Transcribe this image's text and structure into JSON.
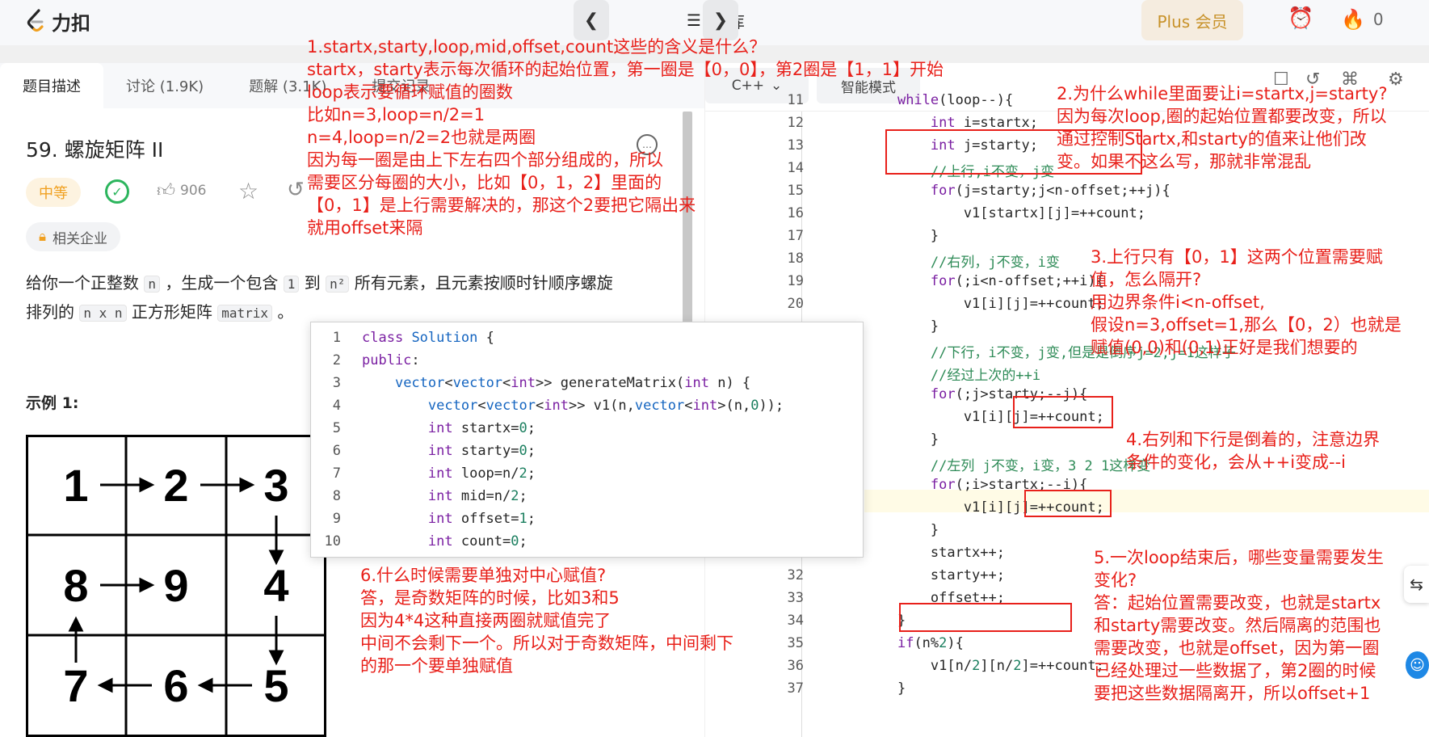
{
  "header": {
    "logo_text": "力扣",
    "prev_icon": "chevron-left-icon",
    "problem_list_label": "题库",
    "next_icon": "chevron-right-icon",
    "plus_label": "Plus 会员",
    "streak_count": "0"
  },
  "left_tabs": [
    "题目描述",
    "讨论 (1.9K)",
    "题解 (3.1K)",
    "提交记录"
  ],
  "problem": {
    "title": "59. 螺旋矩阵 II",
    "difficulty": "中等",
    "likes": "906",
    "company_label": "相关企业",
    "desc_line1_a": "给你一个正整数",
    "desc_n": "n",
    "desc_line1_b": "，生成一个包含",
    "desc_1": "1",
    "desc_line1_c": "到",
    "desc_n2": "n²",
    "desc_line1_d": "所有元素，且元素按顺时针顺序螺旋",
    "desc_line2_a": "排列的",
    "desc_nxn": "n x n",
    "desc_line2_b": "正方形矩阵",
    "desc_matrix": "matrix",
    "desc_line2_c": "。",
    "example_title": "示例 1:",
    "grid": [
      "1",
      "2",
      "3",
      "8",
      "9",
      "4",
      "7",
      "6",
      "5"
    ]
  },
  "editor": {
    "lang": "C++",
    "mode": "智能模式",
    "lines": [
      {
        "n": "11",
        "code": "    while(loop--){"
      },
      {
        "n": "12",
        "code": "        int i=startx;"
      },
      {
        "n": "13",
        "code": "        int j=starty;"
      },
      {
        "n": "14",
        "code": "        //上行,i不变，j变"
      },
      {
        "n": "15",
        "code": "        for(j=starty;j<n-offset;++j){"
      },
      {
        "n": "16",
        "code": "            v1[startx][j]=++count;"
      },
      {
        "n": "17",
        "code": "        }"
      },
      {
        "n": "18",
        "code": "        //右列，j不变，i变"
      },
      {
        "n": "19",
        "code": "        for(;i<n-offset;++i){"
      },
      {
        "n": "20",
        "code": "            v1[i][j]=++count;"
      },
      {
        "n": "",
        "code": "        }"
      },
      {
        "n": "",
        "code": "        //下行，i不变，j变,但是是倒序j=2,j=1这样子"
      },
      {
        "n": "",
        "code": "        //经过上次的++i"
      },
      {
        "n": "",
        "code": "        for(;j>starty;--j){"
      },
      {
        "n": "",
        "code": "            v1[i][j]=++count;"
      },
      {
        "n": "",
        "code": "        }"
      },
      {
        "n": "",
        "code": "        //左列 j不变，i变，3 2 1这样变"
      },
      {
        "n": "",
        "code": "        for(;i>startx;--i){"
      },
      {
        "n": "",
        "code": "            v1[i][j]=++count;"
      },
      {
        "n": "",
        "code": "        }"
      },
      {
        "n": "31",
        "code": "        startx++;"
      },
      {
        "n": "32",
        "code": "        starty++;"
      },
      {
        "n": "33",
        "code": "        offset++;"
      },
      {
        "n": "34",
        "code": "    }"
      },
      {
        "n": "35",
        "code": "    if(n%2){"
      },
      {
        "n": "36",
        "code": "        v1[n/2][n/2]=++count;"
      },
      {
        "n": "37",
        "code": "    }"
      }
    ]
  },
  "popup": {
    "lines": [
      {
        "n": "1",
        "code": "class Solution {"
      },
      {
        "n": "2",
        "code": "public:"
      },
      {
        "n": "3",
        "code": "    vector<vector<int>> generateMatrix(int n) {"
      },
      {
        "n": "4",
        "code": "        vector<vector<int>> v1(n,vector<int>(n,0));"
      },
      {
        "n": "5",
        "code": "        int startx=0;"
      },
      {
        "n": "6",
        "code": "        int starty=0;"
      },
      {
        "n": "7",
        "code": "        int loop=n/2;"
      },
      {
        "n": "8",
        "code": "        int mid=n/2;"
      },
      {
        "n": "9",
        "code": "        int offset=1;"
      },
      {
        "n": "10",
        "code": "        int count=0;"
      }
    ]
  },
  "notes": {
    "note1": [
      "1.startx,starty,loop,mid,offset,count这些的含义是什么？",
      "startx，starty表示每次循环的起始位置，第一圈是【0，0】，第2圈是【1，1】开始",
      "loop表示要循环赋值的圈数",
      "比如n=3,loop=n/2=1",
      "n=4,loop=n/2=2也就是两圈",
      "因为每一圈是由上下左右四个部分组成的，所以",
      "需要区分每圈的大小，比如【0，1，2】里面的",
      "【0，1】是上行需要解决的，那这个2要把它隔出来",
      "就用offset来隔"
    ],
    "note2": [
      "2.为什么while里面要让i=startx,j=starty?",
      "因为每次loop,圈的起始位置都要改变，所以",
      "通过控制Startx,和starty的值来让他们改",
      "变。如果不这么写，那就非常混乱"
    ],
    "note3": [
      "3.上行只有【0，1】这两个位置需要赋",
      "值，怎么隔开?",
      "用边界条件i<n-offset,",
      "假设n=3,offset=1,那么【0，2）也就是",
      "赋值(0,0)和(0,1)正好是我们想要的"
    ],
    "note4": [
      "4.右列和下行是倒着的，注意边界",
      "条件的变化，会从++i变成--i"
    ],
    "note5": [
      "5.一次loop结束后，哪些变量需要发生",
      "变化?",
      "答：起始位置需要改变，也就是startx",
      "和starty需要改变。然后隔离的范围也",
      "需要改变，也就是offset，因为第一圈",
      "已经处理过一些数据了，第2圈的时候",
      "要把这些数据隔离开，所以offset+1"
    ],
    "note6": [
      "6.什么时候需要单独对中心赋值?",
      "答，是奇数矩阵的时候，比如3和5",
      "因为4*4这种直接两圈就赋值完了",
      "中间不会剩下一个。所以对于奇数矩阵，中间剩下",
      "的那一个要单独赋值"
    ]
  },
  "colors": {
    "annotation": "#e8201a",
    "accent": "#c8922a",
    "difficulty": "#f0a020",
    "solved": "#2cb55d"
  }
}
